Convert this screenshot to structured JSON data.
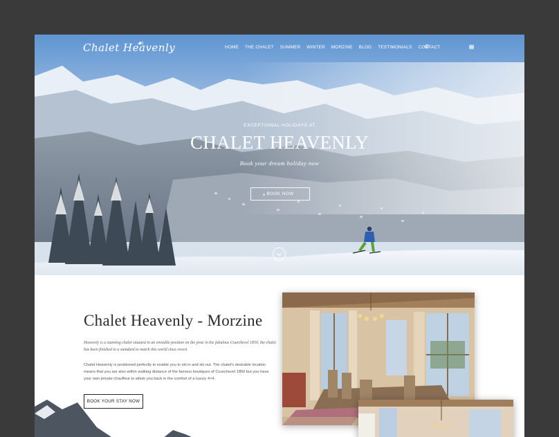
{
  "brand": {
    "logo_text": "Chalet Heavenly"
  },
  "nav": {
    "items": [
      "HOME",
      "THE CHALET",
      "SUMMER",
      "WINTER",
      "MORZINE",
      "BLOG",
      "TESTIMONIALS",
      "CONTACT"
    ]
  },
  "hero": {
    "pretitle": "EXCEPTIONAL HOLIDAYS AT",
    "title": "CHALET HEAVENLY",
    "subtitle": "Book your dream holiday now",
    "cta": "BOOK NOW"
  },
  "content": {
    "title": "Chalet Heavenly - Morzine",
    "intro": "Heavenly is a stunning chalet situated in an enviable position on the piste in the fabulous Courchevel 1850, the chalet has been finished to a standard to match this world class resort.",
    "body": "Chalet Heavenly is positioned perfectly to enable you to ski in and ski out. The chalet's desirable location means that you are also within walking distance of the famous boutiques of Courchevel 1850 but you have your own private chauffeur to whisk you back in the comfort of a luxury 4×4.",
    "cta": "BOOK YOUR STAY NOW"
  },
  "colors": {
    "frame": "#3a3a3a",
    "sky": "#6fa0d6",
    "skier_jacket": "#2e5fb0"
  }
}
